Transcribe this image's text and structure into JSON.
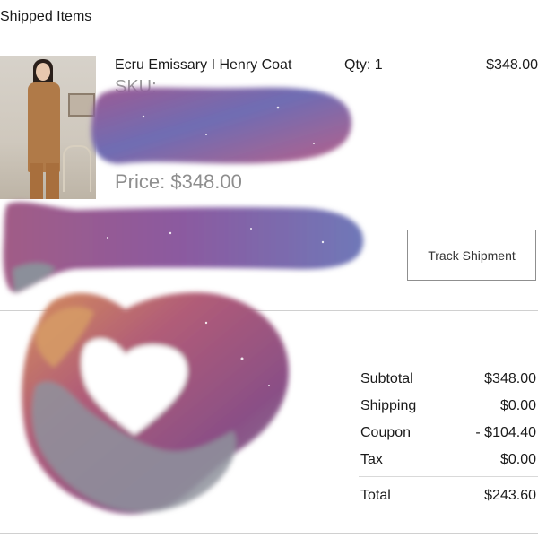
{
  "shipment": {
    "title": "Shipped Items"
  },
  "item": {
    "name": "Ecru Emissary I Henry Coat",
    "qty": "Qty: 1",
    "line_price": "$348.00",
    "sku_label": "SKU:",
    "price_label": "Price: $348.00"
  },
  "actions": {
    "track_label": "Track Shipment"
  },
  "summary": {
    "rows": [
      {
        "label": "Subtotal",
        "value": "$348.00"
      },
      {
        "label": "Shipping",
        "value": "$0.00"
      },
      {
        "label": "Coupon",
        "value": "- $104.40"
      },
      {
        "label": "Tax",
        "value": "$0.00"
      }
    ],
    "total_label": "Total",
    "total_value": "$243.60"
  },
  "colors": {
    "nebula_pink": "#b05a8c",
    "nebula_blue": "#6a6bb4",
    "mountain_orange": "#d28f5c",
    "mountain_grey": "#8a8f9a"
  }
}
